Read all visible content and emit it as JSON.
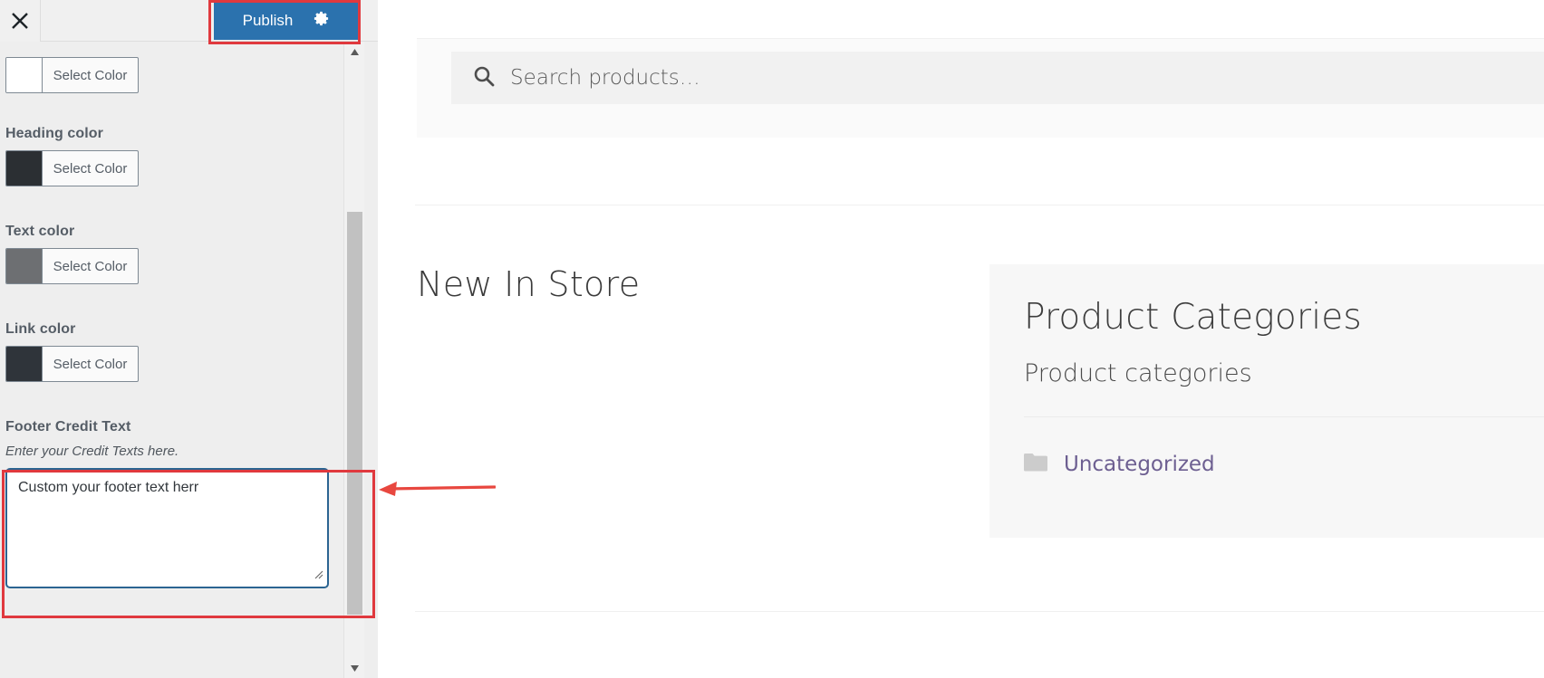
{
  "customizer": {
    "close_icon": "close-icon",
    "publish_label": "Publish",
    "gear_icon": "gear-icon",
    "controls": [
      {
        "label": "",
        "swatch_color": "#ffffff",
        "button_label": "Select Color"
      },
      {
        "label": "Heading color",
        "swatch_color": "#2b2f33",
        "button_label": "Select Color"
      },
      {
        "label": "Text color",
        "swatch_color": "#6d6f72",
        "button_label": "Select Color"
      },
      {
        "label": "Link color",
        "swatch_color": "#2f343a",
        "button_label": "Select Color"
      }
    ],
    "footer_credit": {
      "label": "Footer Credit Text",
      "description": "Enter your Credit Texts here.",
      "value": "Custom your footer text herr",
      "placeholder": ""
    },
    "scrollbar": {
      "up_icon": "chevron-up-icon",
      "down_icon": "chevron-down-icon"
    }
  },
  "preview": {
    "search": {
      "icon": "search-icon",
      "placeholder": "Search products…",
      "value": ""
    },
    "section_heading": "New In Store",
    "category_widget": {
      "title": "Product Categories",
      "subtitle": "Product categories",
      "items": [
        {
          "icon": "folder-icon",
          "label": "Uncategorized"
        }
      ]
    }
  },
  "annotations": {
    "publish_highlight": "red-rectangle",
    "textarea_highlight": "red-rectangle",
    "pointer": "red-arrow-left"
  },
  "colors": {
    "publish_button": "#2b72ae",
    "annotation_red": "#e0393e",
    "link_purple": "#6d5f91",
    "panel_background": "#eeeeee"
  }
}
